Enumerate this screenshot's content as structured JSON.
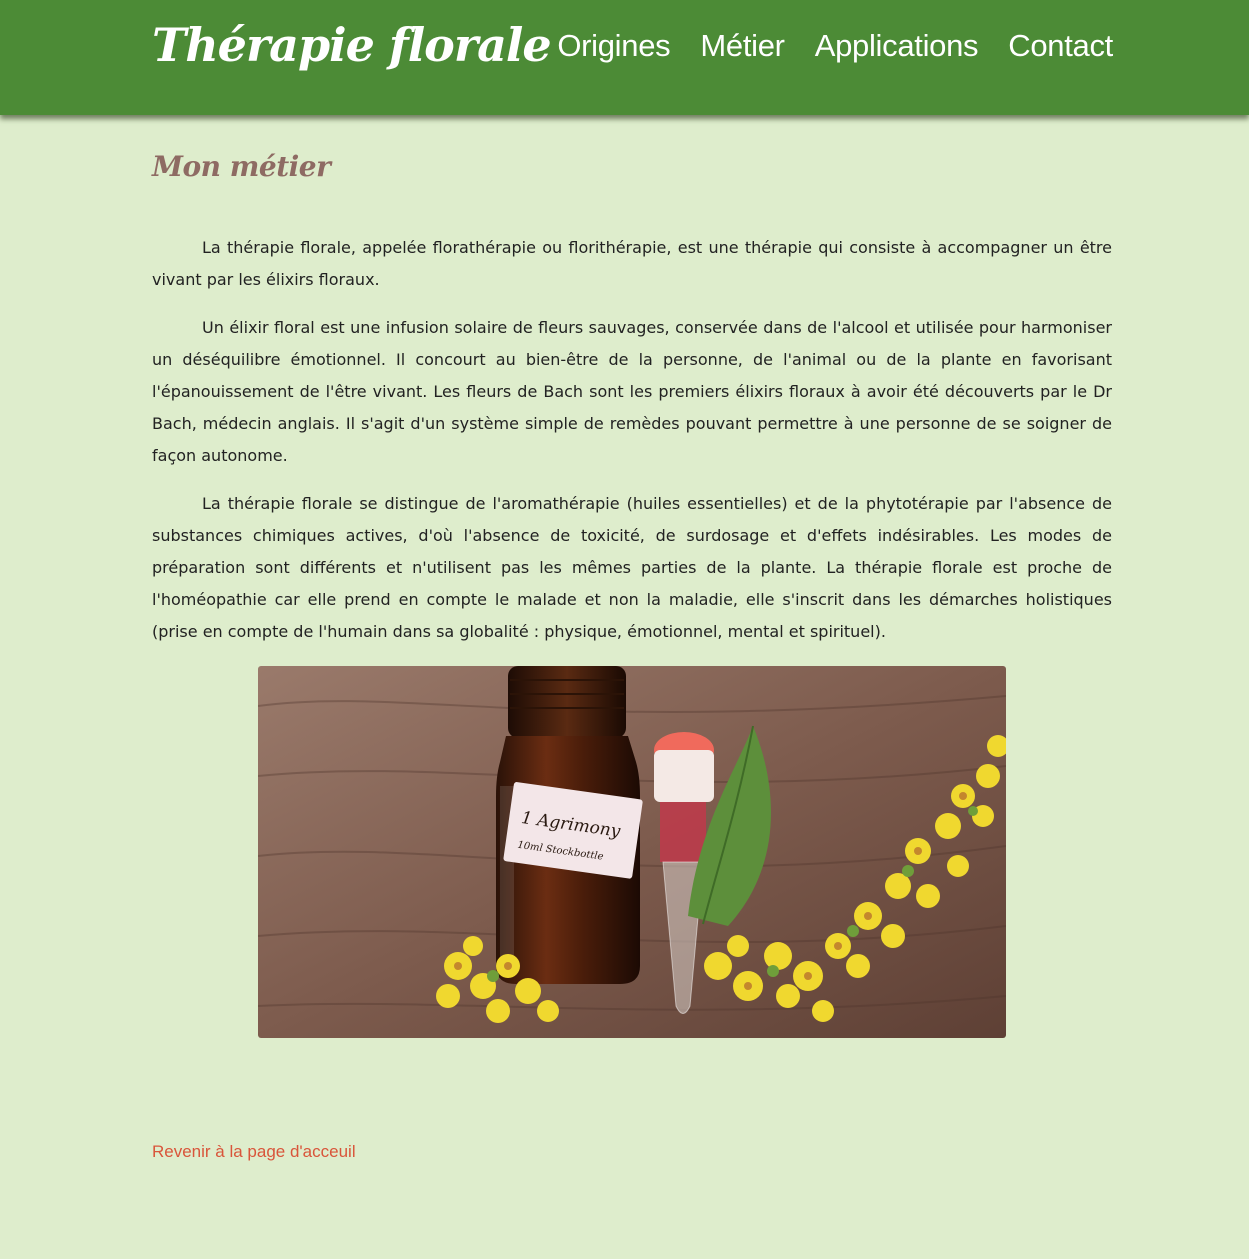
{
  "header": {
    "logo_text": "Thérapie florale",
    "nav": [
      {
        "label": "Origines"
      },
      {
        "label": "Métier"
      },
      {
        "label": "Applications"
      },
      {
        "label": "Contact"
      }
    ]
  },
  "main": {
    "title": "Mon métier",
    "paragraphs": [
      "La thérapie florale, appelée florathérapie ou florithérapie, est une thérapie qui consiste à accompagner un être vivant par les élixirs floraux.",
      "Un élixir floral est une infusion solaire de fleurs sauvages, conservée dans de l'alcool et utilisée pour harmoniser un déséquilibre émotionnel. Il concourt au bien-être de la personne, de l'animal ou de la plante en favorisant l'épanouissement de l'être vivant. Les fleurs de Bach sont les premiers élixirs floraux à avoir été découverts par le Dr Bach, médecin anglais. Il s'agit d'un système simple de remèdes pouvant permettre à une personne de se soigner de façon autonome.",
      "La thérapie florale se distingue de l'aromathérapie (huiles essentielles) et de la phytotérapie par l'absence de substances chimiques actives, d'où l'absence de toxicité, de surdosage et d'effets indésirables. Les modes de préparation sont différents et n'utilisent pas les mêmes parties de la plante. La thérapie florale est proche de l'homéopathie car elle prend en compte le malade et non la maladie, elle s'inscrit dans les démarches holistiques (prise en compte de l'humain dans sa globalité : physique, émotionnel, mental et spirituel)."
    ],
    "image": {
      "label_line1": "1 Agrimony",
      "label_line2": "10ml Stockbottle"
    }
  },
  "footer": {
    "back_link": "Revenir à la page d'acceuil"
  },
  "colors": {
    "header_bg": "#4c8b36",
    "page_bg": "#deedcc",
    "title": "#8e6b63",
    "link": "#d9553a"
  }
}
